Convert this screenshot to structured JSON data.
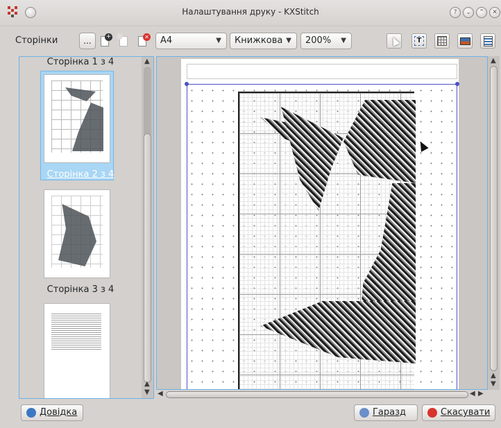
{
  "window": {
    "title": "Налаштування друку - KXStitch",
    "controls": [
      "help-button",
      "minimize-button",
      "maximize-button",
      "close-button"
    ]
  },
  "toolbar": {
    "pages_label": "Сторінки",
    "more_label": "...",
    "paper_size": "A4",
    "orientation": "Книжкова",
    "zoom": "200%"
  },
  "thumbnails": [
    {
      "caption": "Сторінка 1 з 4"
    },
    {
      "caption": "Сторінка 2 з 4",
      "selected": true
    },
    {
      "caption": "Сторінка 3 з 4"
    }
  ],
  "buttons": {
    "help": "Довідка",
    "ok": "Гаразд",
    "cancel": "Скасувати"
  },
  "colors": {
    "selection": "#a8d6f4",
    "focus_border": "#6fb2e3",
    "print_frame": "#4a51c4"
  }
}
